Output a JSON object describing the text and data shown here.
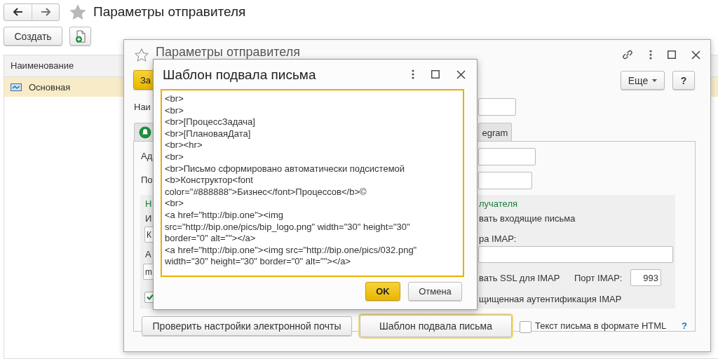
{
  "page_title": "Параметры отправителя",
  "toolbar": {
    "create_button": "Создать"
  },
  "list": {
    "columns": [
      "Наименование"
    ],
    "rows": [
      {
        "name": "Основная",
        "selected": true
      }
    ]
  },
  "sender_window": {
    "title": "Параметры отправителя",
    "more_button": "Еще",
    "help_button": "?",
    "primary_button": "За",
    "name_label": "Наи",
    "tabs": [
      {
        "kind": "icon"
      },
      {
        "kind": "text",
        "label": "egram"
      }
    ],
    "address_label": "Ад",
    "po_label": "По",
    "group": {
      "title_start": "Н",
      "title_end": "лучателя",
      "label_i": "И",
      "incoming_text": "вать входящие письма",
      "field_k_value": "К",
      "imap_server_label": "ра IMAP:",
      "label_a": "А",
      "field_m_value": "m",
      "ssl_text": "вать SSL для IMAP",
      "port_label": "Порт IMAP:",
      "port_value": "993",
      "secure_auth_checked": true,
      "secure_auth_text": "щищенная аутентификация IMAP"
    },
    "check_button": "Проверить настройки электронной почты",
    "footer_button": "Шаблон подвала письма",
    "html_checkbox": {
      "label": "Текст письма в формате HTML",
      "checked": false
    },
    "html_help": "?"
  },
  "dialog": {
    "title": "Шаблон подвала письма",
    "lines": [
      "<br>",
      "<br>",
      "<br>[ПроцессЗадача]",
      "<br>[ПлановаяДата]",
      "<br><hr>",
      "<br>",
      "<br>Письмо сформировано автоматически подсистемой",
      "<b>Конструктор<font",
      "color=\"#888888\">Бизнес</font>Процессов</b>©",
      "<br>",
      "<a href=\"http://bip.one\"><img",
      "src=\"http://bip.one/pics/bip_logo.png\" width=\"30\" height=\"30\"",
      "border=\"0\" alt=\"\"></a>",
      "<a href=\"http://bip.one\"><img src=\"http://bip.one/pics/032.png\"",
      "width=\"30\" height=\"30\" border=\"0\" alt=\"\"></a>"
    ],
    "ok_button": "OK",
    "cancel_button": "Отмена"
  }
}
